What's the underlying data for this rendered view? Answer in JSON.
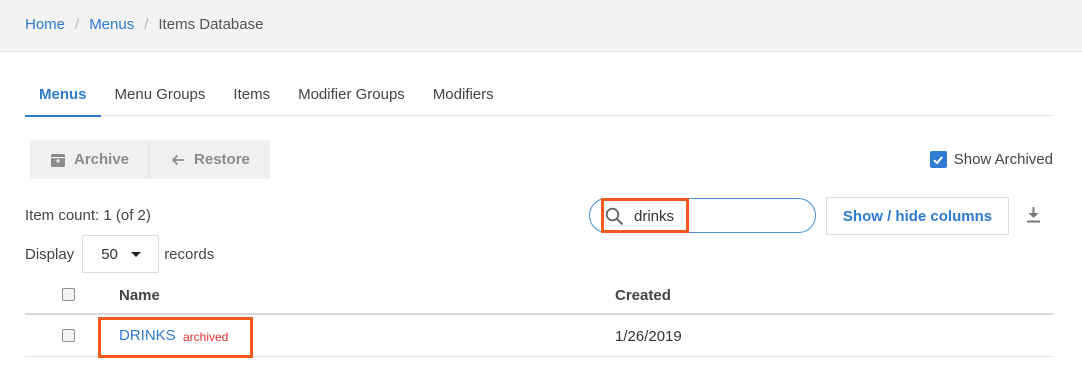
{
  "breadcrumb": {
    "items": [
      {
        "label": "Home"
      },
      {
        "label": "Menus"
      },
      {
        "label": "Items Database"
      }
    ],
    "separator": "/"
  },
  "tabs": [
    {
      "label": "Menus",
      "active": true
    },
    {
      "label": "Menu Groups",
      "active": false
    },
    {
      "label": "Items",
      "active": false
    },
    {
      "label": "Modifier Groups",
      "active": false
    },
    {
      "label": "Modifiers",
      "active": false
    }
  ],
  "toolbar": {
    "archive_label": "Archive",
    "restore_label": "Restore",
    "show_archived_label": "Show Archived",
    "show_archived_checked": true
  },
  "item_count": "Item count: 1 (of 2)",
  "search": {
    "value": "drinks",
    "icon": "search-icon"
  },
  "columns_button_label": "Show / hide columns",
  "display": {
    "prefix": "Display",
    "value": "50",
    "suffix": "records"
  },
  "table": {
    "headers": {
      "name": "Name",
      "created": "Created"
    },
    "rows": [
      {
        "name": "DRINKS",
        "badge": "archived",
        "created": "1/26/2019"
      }
    ]
  },
  "colors": {
    "accent": "#2e7bd1",
    "highlight": "#f25a1b",
    "archived_badge": "#e3302f"
  }
}
